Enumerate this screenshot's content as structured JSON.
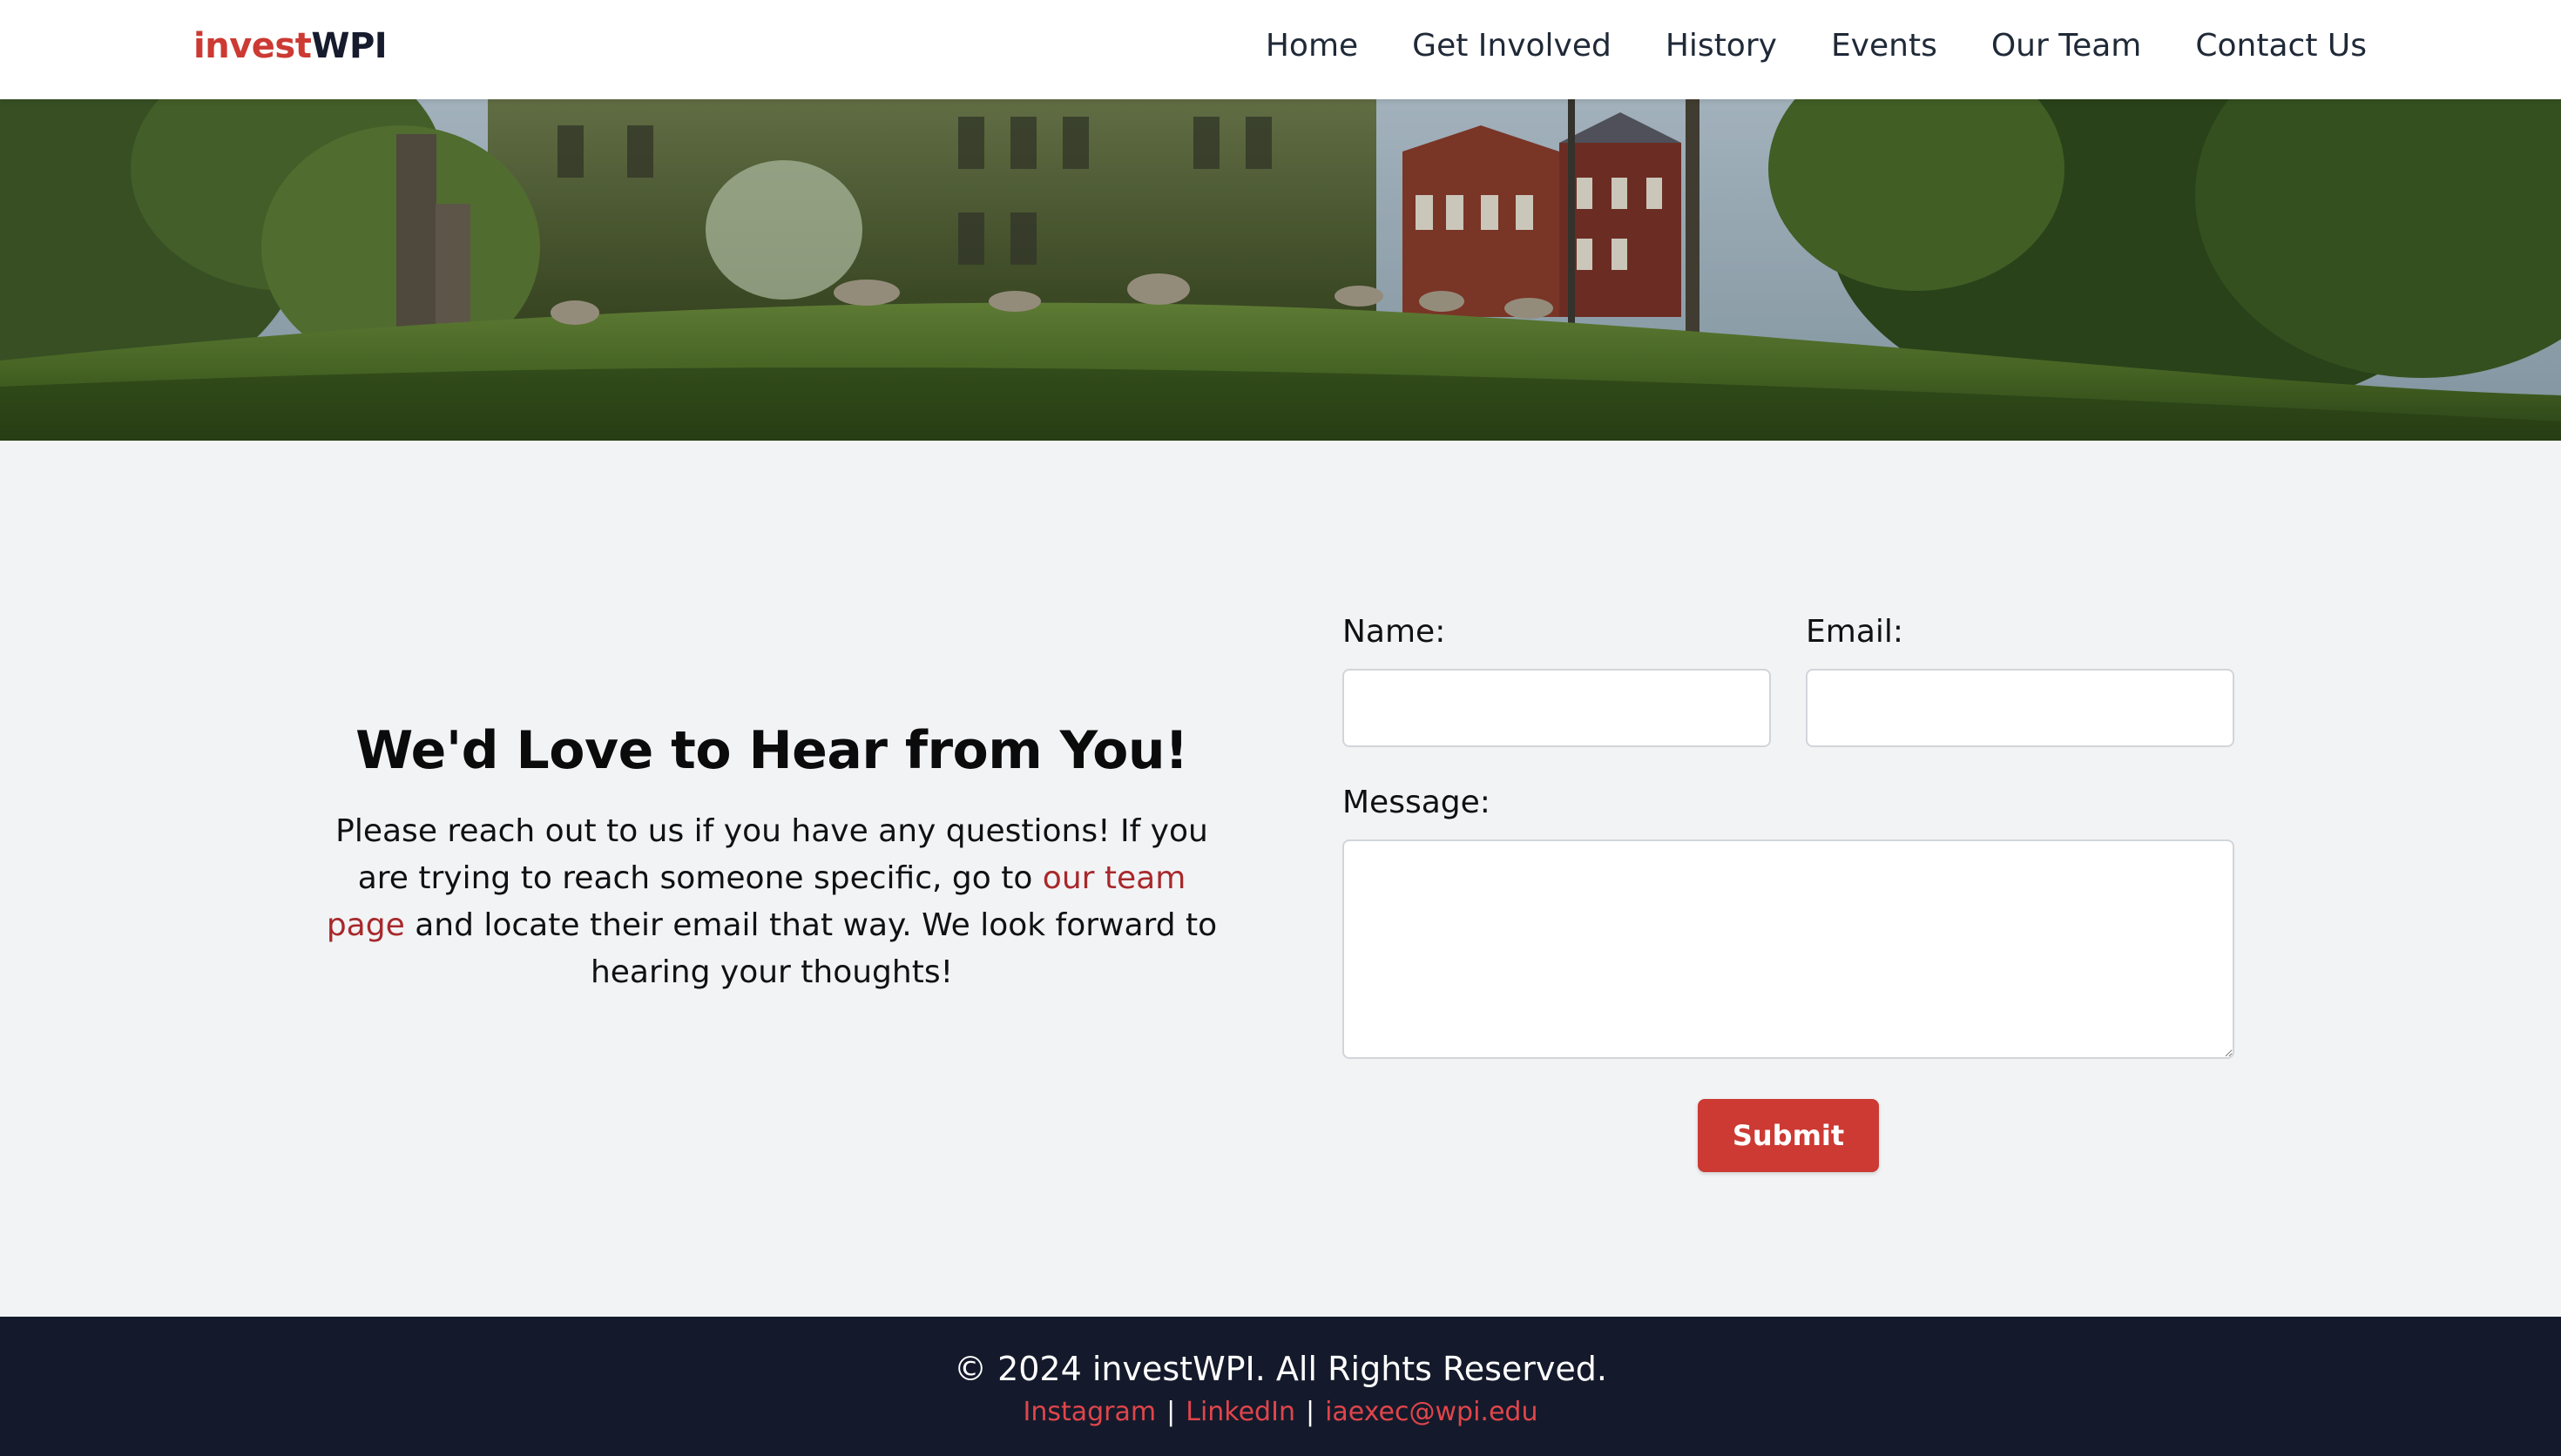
{
  "brand": {
    "part1": "invest",
    "part2": "WPI",
    "accent_color": "#cc3a33",
    "dark_color": "#161b2e"
  },
  "nav": {
    "items": [
      {
        "label": "Home"
      },
      {
        "label": "Get Involved"
      },
      {
        "label": "History"
      },
      {
        "label": "Events"
      },
      {
        "label": "Our Team"
      },
      {
        "label": "Contact Us"
      }
    ]
  },
  "contact": {
    "heading": "We'd Love to Hear from You!",
    "body_before": "Please reach out to us if you have any questions! If you are trying to reach someone specific, go to ",
    "body_link": "our team page",
    "body_after": " and locate their email that way. We look forward to hearing your thoughts!"
  },
  "form": {
    "name_label": "Name:",
    "name_value": "",
    "email_label": "Email:",
    "email_value": "",
    "message_label": "Message:",
    "message_value": "",
    "submit_label": "Submit"
  },
  "footer": {
    "copyright": "© 2024 investWPI. All Rights Reserved.",
    "instagram": "Instagram",
    "linkedin": "LinkedIn",
    "email": "iaexec@wpi.edu",
    "separator": "|",
    "bg_color": "#141a2b",
    "link_color": "#e0454b"
  }
}
